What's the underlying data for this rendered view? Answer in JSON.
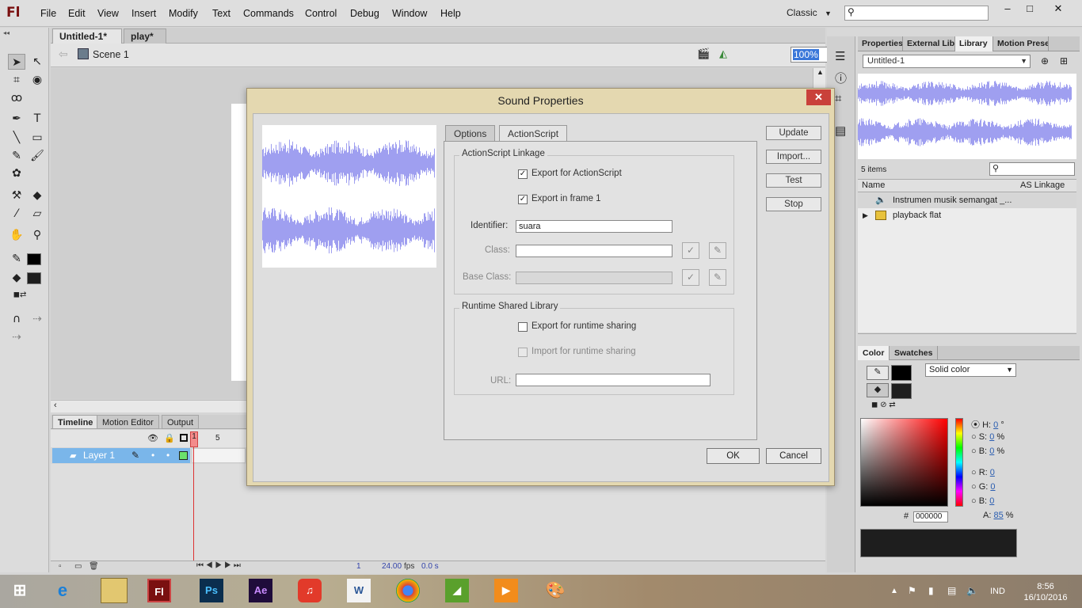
{
  "app": {
    "logo": "Fl"
  },
  "menu": [
    "File",
    "Edit",
    "View",
    "Insert",
    "Modify",
    "Text",
    "Commands",
    "Control",
    "Debug",
    "Window",
    "Help"
  ],
  "workspace": "Classic",
  "doc_tabs": [
    {
      "label": "Untitled-1*",
      "close": "×"
    },
    {
      "label": "play*",
      "close": "×"
    }
  ],
  "scene": {
    "label": "Scene 1",
    "zoom": "100%"
  },
  "timeline": {
    "tabs": [
      "Timeline",
      "Motion Editor",
      "Output"
    ],
    "layer": "Layer 1",
    "frame_markers": [
      "1",
      "5"
    ],
    "footer": {
      "frame": "1",
      "fps": "24.00",
      "fps_unit": "fps",
      "time": "0.0 s"
    }
  },
  "library": {
    "tabs": [
      "Properties",
      "External Libr",
      "Library",
      "Motion Prese"
    ],
    "active_tab": "Library",
    "doc_select": "Untitled-1",
    "items_count": "5 items",
    "col_name": "Name",
    "col_linkage": "AS Linkage",
    "items": [
      {
        "name": "Instrumen musik semangat _..."
      },
      {
        "name": "playback flat"
      }
    ]
  },
  "color_panel": {
    "tabs": [
      "Color",
      "Swatches"
    ],
    "type": "Solid color",
    "hsb": [
      {
        "label": "H:",
        "value": "0",
        "unit": "°"
      },
      {
        "label": "S:",
        "value": "0",
        "unit": "%"
      },
      {
        "label": "B:",
        "value": "0",
        "unit": "%"
      }
    ],
    "rgb": [
      {
        "label": "R:",
        "value": "0"
      },
      {
        "label": "G:",
        "value": "0"
      },
      {
        "label": "B:",
        "value": "0"
      }
    ],
    "alpha": {
      "label": "A:",
      "value": "85",
      "unit": "%"
    },
    "hex_prefix": "#",
    "hex": "000000"
  },
  "dialog": {
    "title": "Sound Properties",
    "close": "✕",
    "tabs": [
      "Options",
      "ActionScript"
    ],
    "active_tab": "ActionScript",
    "linkage": {
      "title": "ActionScript Linkage",
      "export_as": "Export for ActionScript",
      "export_frame1": "Export in frame 1",
      "identifier_label": "Identifier:",
      "identifier_value": "suara",
      "class_label": "Class:",
      "base_class_label": "Base Class:"
    },
    "rsl": {
      "title": "Runtime Shared Library",
      "export_runtime": "Export for runtime sharing",
      "import_runtime": "Import for runtime sharing",
      "url_label": "URL:"
    },
    "side_buttons": [
      "Update",
      "Import...",
      "Test",
      "Stop"
    ],
    "ok": "OK",
    "cancel": "Cancel"
  },
  "taskbar": {
    "lang": "IND",
    "time": "8:56",
    "date": "16/10/2016"
  },
  "colors": {
    "accent": "#3a77d9",
    "wave": "#9f9ff0",
    "layer_sel": "#7ab6ea",
    "close_red": "#c9413a"
  }
}
